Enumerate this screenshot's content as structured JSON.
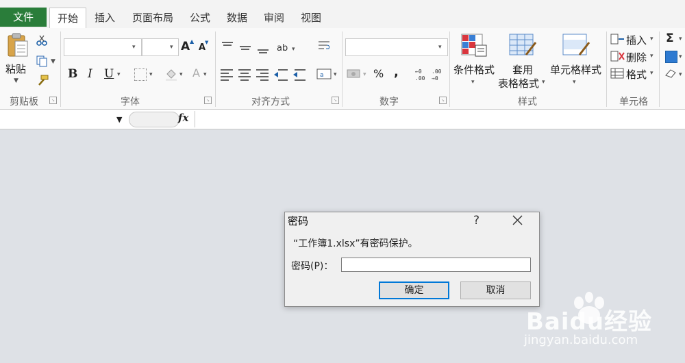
{
  "tabs": {
    "file": "文件",
    "home": "开始",
    "insert": "插入",
    "page_layout": "页面布局",
    "formulas": "公式",
    "data": "数据",
    "review": "审阅",
    "view": "视图"
  },
  "ribbon": {
    "clipboard": {
      "group_label": "剪贴板",
      "paste_label": "粘贴"
    },
    "font": {
      "group_label": "字体",
      "bold": "B",
      "italic": "I",
      "underline": "U",
      "grow": "A",
      "shrink": "A",
      "font_color": "A"
    },
    "alignment": {
      "group_label": "对齐方式"
    },
    "number": {
      "group_label": "数字",
      "percent": "%",
      "comma": ","
    },
    "styles": {
      "group_label": "样式",
      "conditional_format": "条件格式",
      "format_as_table_line1": "套用",
      "format_as_table_line2": "表格格式",
      "cell_styles": "单元格样式"
    },
    "cells": {
      "group_label": "单元格",
      "insert": "插入",
      "delete": "删除",
      "format": "格式"
    },
    "editing": {
      "sigma": "Σ"
    }
  },
  "formula_bar": {
    "fx": "fx"
  },
  "dialog": {
    "title": "密码",
    "help": "?",
    "message": "“工作簿1.xlsx”有密码保护。",
    "password_label": "密码(P)：",
    "password_value": "",
    "ok": "确定",
    "cancel": "取消"
  },
  "watermark": {
    "brand": "Baidu经验",
    "url": "jingyan.baidu.com"
  },
  "colors": {
    "file_tab": "#2a7d3a",
    "ok_border": "#0078d7",
    "workspace": "#dee1e6"
  }
}
